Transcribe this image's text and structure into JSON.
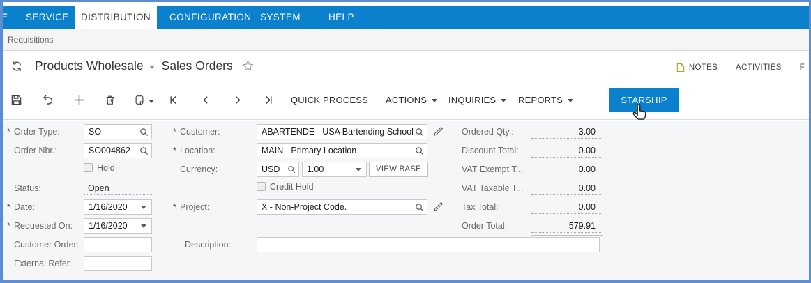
{
  "colors": {
    "accent_blue": "#0b80cd",
    "frame_blue": "#5d8ed2",
    "form_bg": "#f4f6f8"
  },
  "nav": {
    "partial_item": "E",
    "items": [
      {
        "label": "SERVICE"
      },
      {
        "label": "DISTRIBUTION"
      },
      {
        "label": "CONFIGURATION"
      },
      {
        "label": "SYSTEM"
      },
      {
        "label": "HELP"
      }
    ]
  },
  "breadcrumb": "Requisitions",
  "header": {
    "module": "Products Wholesale",
    "page": "Sales Orders",
    "notes_label": "NOTES",
    "activities_label": "ACTIVITIES",
    "files_label": "F"
  },
  "toolbar": {
    "quick_process_label": "QUICK PROCESS",
    "actions_label": "ACTIONS",
    "inquiries_label": "INQUIRIES",
    "reports_label": "REPORTS",
    "starship_label": "STARSHIP"
  },
  "form": {
    "required_marker": "*",
    "left": {
      "order_type_label": "Order Type:",
      "order_type_value": "SO",
      "order_nbr_label": "Order Nbr.:",
      "order_nbr_value": "SO004862",
      "hold_label": "Hold",
      "status_label": "Status:",
      "status_value": "Open",
      "date_label": "Date:",
      "date_value": "1/16/2020",
      "requested_on_label": "Requested On:",
      "requested_on_value": "1/16/2020",
      "customer_order_label": "Customer Order:",
      "customer_order_value": "",
      "external_ref_label": "External Refer...",
      "external_ref_value": ""
    },
    "middle": {
      "customer_label": "Customer:",
      "customer_value": "ABARTENDE - USA Bartending School",
      "location_label": "Location:",
      "location_value": "MAIN - Primary Location",
      "currency_label": "Currency:",
      "currency_code": "USD",
      "currency_rate": "1.00",
      "view_base_label": "VIEW BASE",
      "credit_hold_label": "Credit Hold",
      "project_label": "Project:",
      "project_value": "X - Non-Project Code.",
      "description_label": "Description:",
      "description_value": ""
    },
    "totals": [
      {
        "label": "Ordered Qty.:",
        "value": "3.00"
      },
      {
        "label": "Discount Total:",
        "value": "0.00"
      },
      {
        "label": "VAT Exempt T...",
        "value": "0.00"
      },
      {
        "label": "VAT Taxable T...",
        "value": "0.00"
      },
      {
        "label": "Tax Total:",
        "value": "0.00"
      },
      {
        "label": "Order Total:",
        "value": "579.91"
      }
    ]
  }
}
